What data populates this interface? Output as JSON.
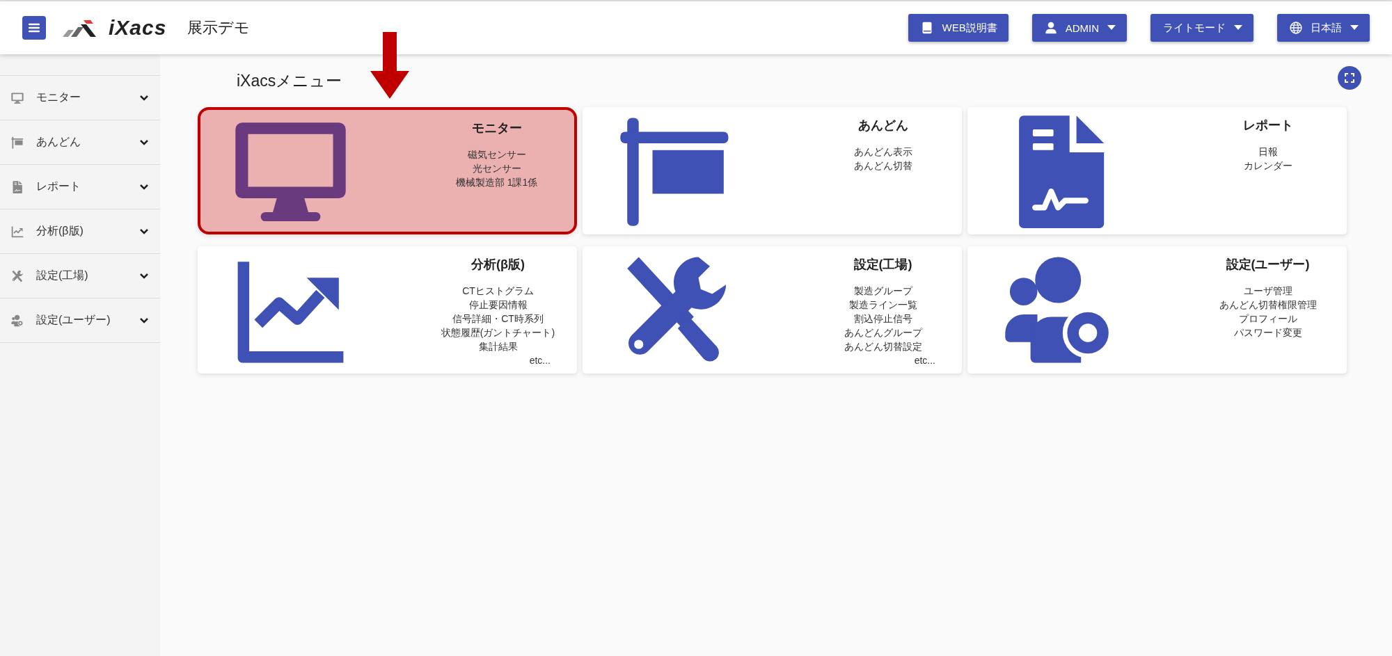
{
  "header": {
    "logo_text": "iXacs",
    "app_title": "展示デモ",
    "buttons": [
      {
        "kind": "manual",
        "label": "WEB説明書",
        "dropdown": false
      },
      {
        "kind": "user",
        "label": "ADMIN",
        "dropdown": true
      },
      {
        "kind": "theme",
        "label": "ライトモード",
        "dropdown": true
      },
      {
        "kind": "language",
        "label": "日本語",
        "dropdown": true
      }
    ]
  },
  "sidebar": {
    "items": [
      {
        "kind": "monitor",
        "label": "モニター"
      },
      {
        "kind": "andon",
        "label": "あんどん"
      },
      {
        "kind": "report",
        "label": "レポート"
      },
      {
        "kind": "analysis",
        "label": "分析(β版)"
      },
      {
        "kind": "factory",
        "label": "設定(工場)"
      },
      {
        "kind": "users",
        "label": "設定(ユーザー)"
      }
    ]
  },
  "page_title": "iXacsメニュー",
  "cards": [
    {
      "kind": "monitor",
      "title": "モニター",
      "selected": true,
      "lines": [
        "磁気センサー",
        "光センサー",
        "機械製造部 1課1係"
      ]
    },
    {
      "kind": "andon",
      "title": "あんどん",
      "selected": false,
      "lines": [
        "あんどん表示",
        "あんどん切替"
      ]
    },
    {
      "kind": "report",
      "title": "レポート",
      "selected": false,
      "lines": [
        "日報",
        "カレンダー"
      ]
    },
    {
      "kind": "analysis",
      "title": "分析(β版)",
      "selected": false,
      "lines": [
        "CTヒストグラム",
        "停止要因情報",
        "信号詳細・CT時系列",
        "状態履歴(ガントチャート)",
        "集計結果"
      ],
      "more": "etc..."
    },
    {
      "kind": "factory",
      "title": "設定(工場)",
      "selected": false,
      "lines": [
        "製造グループ",
        "製造ライン一覧",
        "割込停止信号",
        "あんどんグループ",
        "あんどん切替設定"
      ],
      "more": "etc..."
    },
    {
      "kind": "users",
      "title": "設定(ユーザー)",
      "selected": false,
      "lines": [
        "ユーザ管理",
        "あんどん切替権限管理",
        "プロフィール",
        "パスワード変更"
      ]
    }
  ]
}
